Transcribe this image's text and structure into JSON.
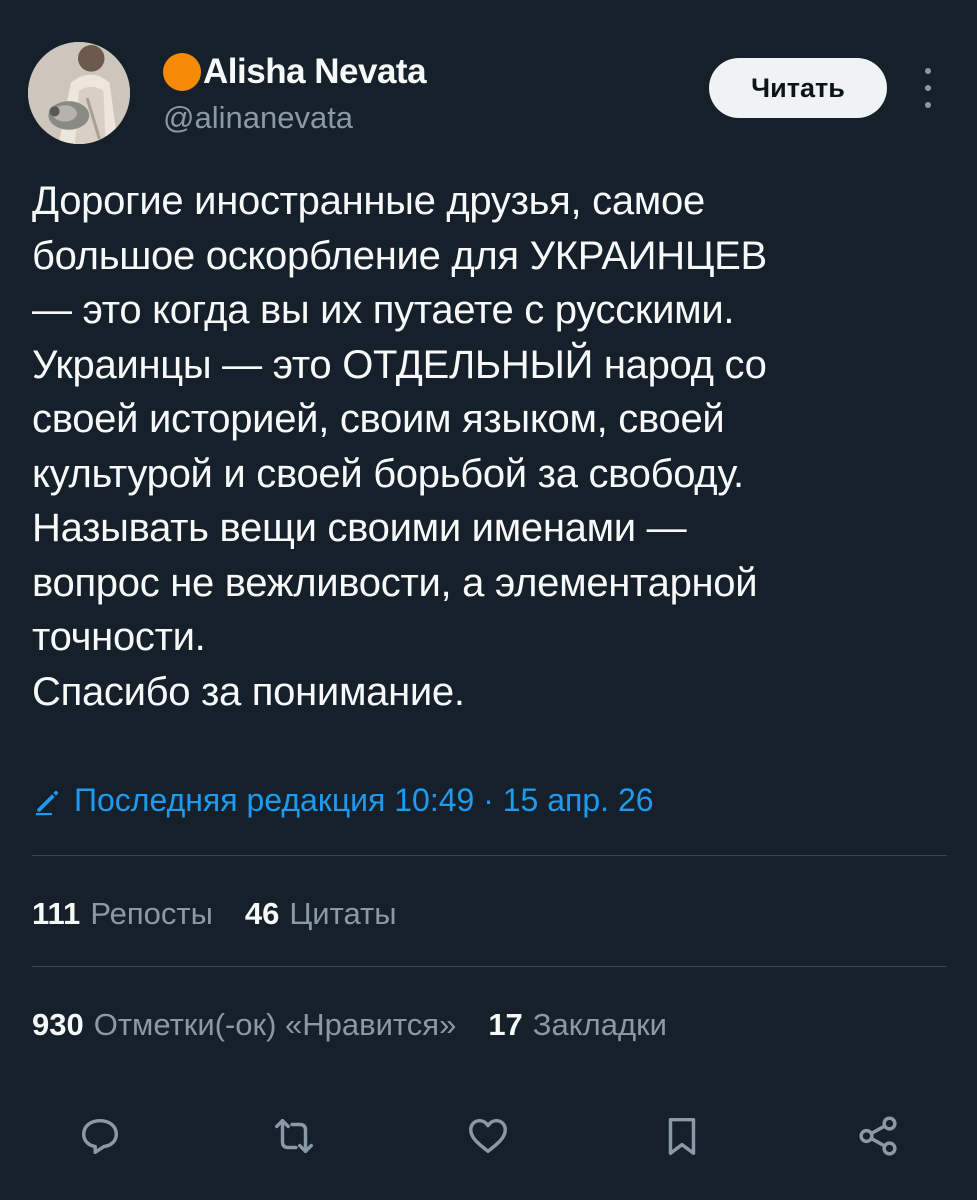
{
  "author": {
    "display_name": "Alisha Nevata",
    "handle": "@alinanevata",
    "badge_color": "#f58a07"
  },
  "header": {
    "follow_label": "Читать"
  },
  "tweet": {
    "text": "Дорогие иностранные друзья, самое\nбольшое оскорбление для УКРАИНЦЕВ\n— это когда вы их путаете с русскими.\nУкраинцы — это ОТДЕЛЬНЫЙ народ со\nсвоей историей, своим языком, своей\nкультурой и своей борьбой за свободу.\nНазывать вещи своими именами —\nвопрос не вежливости, а элементарной\nточности.\nСпасибо за понимание.",
    "edited_label": "Последняя редакция 10:49 · 15 апр. 26"
  },
  "stats": {
    "reposts_count": "111",
    "reposts_label": "Репосты",
    "quotes_count": "46",
    "quotes_label": "Цитаты",
    "likes_count": "930",
    "likes_label": "Отметки(-ок) «Нравится»",
    "bookmarks_count": "17",
    "bookmarks_label": "Закладки"
  },
  "actions": [
    {
      "icon": "reply-icon"
    },
    {
      "icon": "repost-icon"
    },
    {
      "icon": "like-icon"
    },
    {
      "icon": "bookmark-icon"
    },
    {
      "icon": "share-icon"
    }
  ],
  "colors": {
    "background": "#15202b",
    "text": "#f7f9f9",
    "secondary": "#8b98a5",
    "link": "#1d9bf0",
    "divider": "#38444d"
  }
}
